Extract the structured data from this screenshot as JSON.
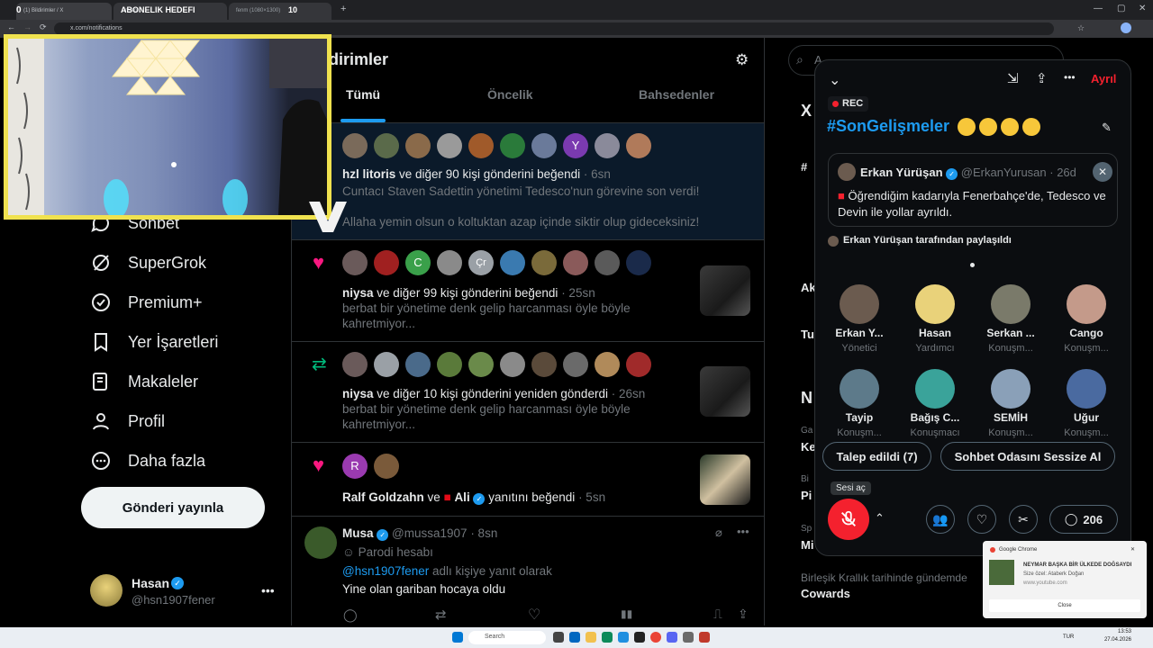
{
  "browser": {
    "tabs": [
      {
        "label": "(1) Bildirimler / X"
      },
      {
        "label": "ABONELIK HEDEFI"
      },
      {
        "label": "...m/sp..."
      },
      {
        "label": "fenm (1080×1300)"
      },
      {
        "label": "10"
      }
    ],
    "url": "x.com/notifications"
  },
  "overlay": {
    "counter_left": "0",
    "goal_title": "ABONELIK HEDEFI",
    "goal_value": "10"
  },
  "nav": {
    "items": [
      {
        "label": "Sohbet",
        "icon": "chat-icon"
      },
      {
        "label": "SuperGrok",
        "icon": "grok-icon"
      },
      {
        "label": "Premium+",
        "icon": "verified-icon"
      },
      {
        "label": "Yer İşaretleri",
        "icon": "bookmark-icon"
      },
      {
        "label": "Makaleler",
        "icon": "article-icon"
      },
      {
        "label": "Profil",
        "icon": "profile-icon"
      },
      {
        "label": "Daha fazla",
        "icon": "more-icon"
      }
    ],
    "post_button": "Gönderi yayınla",
    "account": {
      "name": "Hasan",
      "handle": "@hsn1907fener"
    }
  },
  "main": {
    "title": "ldirimler",
    "tabs": [
      "Tümü",
      "Öncelik",
      "Bahsedenler"
    ],
    "notifications": [
      {
        "line1_name": "hzl litoris",
        "line1_rest": " ve diğer 90 kişi gönderini beğendi",
        "time": "· 6sn",
        "body": "Cuntacı Staven Sadettin yönetimi Tedesco'nun görevine son verdi!",
        "body2": "Allaha yemin olsun o koltuktan azap içinde siktir olup gideceksiniz!"
      },
      {
        "line1_name": "niysa",
        "line1_rest": " ve diğer 99 kişi gönderini beğendi",
        "time": "· 25sn",
        "body": "berbat bir yönetime denk gelip harcanması öyle böyle",
        "body2": "kahretmiyor..."
      },
      {
        "line1_name": "niysa",
        "line1_rest": " ve diğer 10 kişi gönderini yeniden gönderdi",
        "time": "· 26sn",
        "body": "berbat bir yönetime denk gelip harcanması öyle böyle",
        "body2": "kahretmiyor..."
      },
      {
        "line1_name": "Ralf Goldzahn",
        "line1_mid": " ve ",
        "line1_name2": "Ali",
        "line1_rest": " yanıtını beğendi",
        "time": "· 5sn"
      }
    ],
    "reply": {
      "name": "Musa",
      "handle": "@mussa1907",
      "time": "· 8sn",
      "parody": "Parodi hesabı",
      "reply_to_handle": "@hsn1907fener",
      "reply_to_rest": " adlı kişiye yanıt olarak",
      "text": "Yine olan gariban hocaya oldu"
    },
    "avatar_letters": [
      "Y",
      "C",
      "Çr",
      "R"
    ]
  },
  "right_col": {
    "search_placeholder": "A",
    "labels": [
      "X",
      "#",
      "Ak",
      "Tu",
      "N",
      "Ga",
      "Ke",
      "Bi",
      "Pi",
      "Sp",
      "Mi"
    ],
    "trend_context": "Birleşik Krallık tarihinde gündemde",
    "trend_title": "Cowards"
  },
  "space": {
    "leave": "Ayrıl",
    "rec": "REC",
    "title": "#SonGelişmeler",
    "pinned": {
      "name": "Erkan Yürüşan",
      "handle": "@ErkanYurusan",
      "time": "· 26d",
      "text": "Öğrendiğim kadarıyla Fenerbahçe'de, Tedesco ve Devin ile yollar ayrıldı."
    },
    "shared_by": "Erkan Yürüşan tarafından paylaşıldı",
    "speakers": [
      {
        "name": "Erkan Y...",
        "role": "Yönetici",
        "color": "#6b5b4f"
      },
      {
        "name": "Hasan",
        "role": "Yardımcı",
        "color": "#e9d27a"
      },
      {
        "name": "Serkan ...",
        "role": "Konuşm...",
        "color": "#7a7a6a"
      },
      {
        "name": "Cango",
        "role": "Konuşm...",
        "color": "#c49a8a"
      },
      {
        "name": "Tayip",
        "role": "Konuşm...",
        "color": "#5d7a8a"
      },
      {
        "name": "Bağış C...",
        "role": "Konuşmacı",
        "color": "#3aa39a"
      },
      {
        "name": "SEMİH",
        "role": "Konuşm...",
        "color": "#8aa0b8"
      },
      {
        "name": "Uğur",
        "role": "Konuşm...",
        "color": "#4a6aa0"
      }
    ],
    "request_btn": "Talep edildi (7)",
    "mute_room_btn": "Sohbet Odasını Sessize Al",
    "unmute_tooltip": "Sesi aç",
    "comment_count": "206",
    "accent": "#1d9bf0",
    "mic_color": "#f4212e"
  },
  "toast": {
    "app": "Google Chrome",
    "title": "NEYMAR BAŞKA BİR ÜLKEDE DOĞSAYDI",
    "sub": "Size özel: Ataberk Doğan",
    "site": "www.youtube.com",
    "close": "Close"
  },
  "taskbar": {
    "search": "Search",
    "lang": "TUR",
    "time": "13:53",
    "date": "27.04.2026"
  }
}
